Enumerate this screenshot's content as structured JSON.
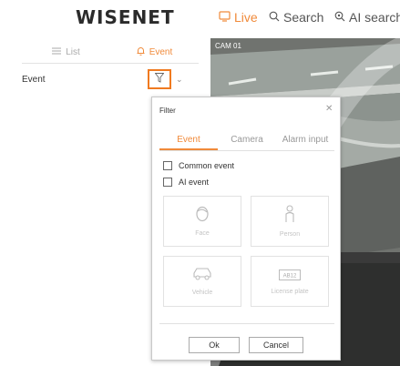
{
  "brand": {
    "logo_text": "WISENET",
    "accent_color": "#f08a3a",
    "highlight_color": "#f07a20"
  },
  "nav": {
    "live_label": "Live",
    "live_icon": "monitor-icon",
    "search_label": "Search",
    "search_icon": "search-icon",
    "ai_label": "AI search",
    "ai_icon": "ai-search-icon"
  },
  "left_panel": {
    "tabs": [
      {
        "label": "List",
        "icon": "list-icon",
        "active": false
      },
      {
        "label": "Event",
        "icon": "bell-icon",
        "active": true
      }
    ],
    "event_row": {
      "label": "Event",
      "filter_icon": "filter-icon",
      "expand_icon": "chevron-down-icon"
    }
  },
  "camera": {
    "label": "CAM 01"
  },
  "filter_dialog": {
    "title": "Filter",
    "close_icon": "close-icon",
    "tabs": [
      {
        "label": "Event",
        "active": true
      },
      {
        "label": "Camera",
        "active": false
      },
      {
        "label": "Alarm input",
        "active": false
      }
    ],
    "options": [
      {
        "label": "Common event",
        "checked": false
      },
      {
        "label": "AI event",
        "checked": false
      }
    ],
    "ai_types": [
      {
        "label": "Face",
        "icon": "face-icon"
      },
      {
        "label": "Person",
        "icon": "person-icon"
      },
      {
        "label": "Vehicle",
        "icon": "vehicle-icon"
      },
      {
        "label": "License plate",
        "icon": "license-plate-icon",
        "icon_text": "AB12"
      }
    ],
    "ok_label": "Ok",
    "cancel_label": "Cancel"
  }
}
